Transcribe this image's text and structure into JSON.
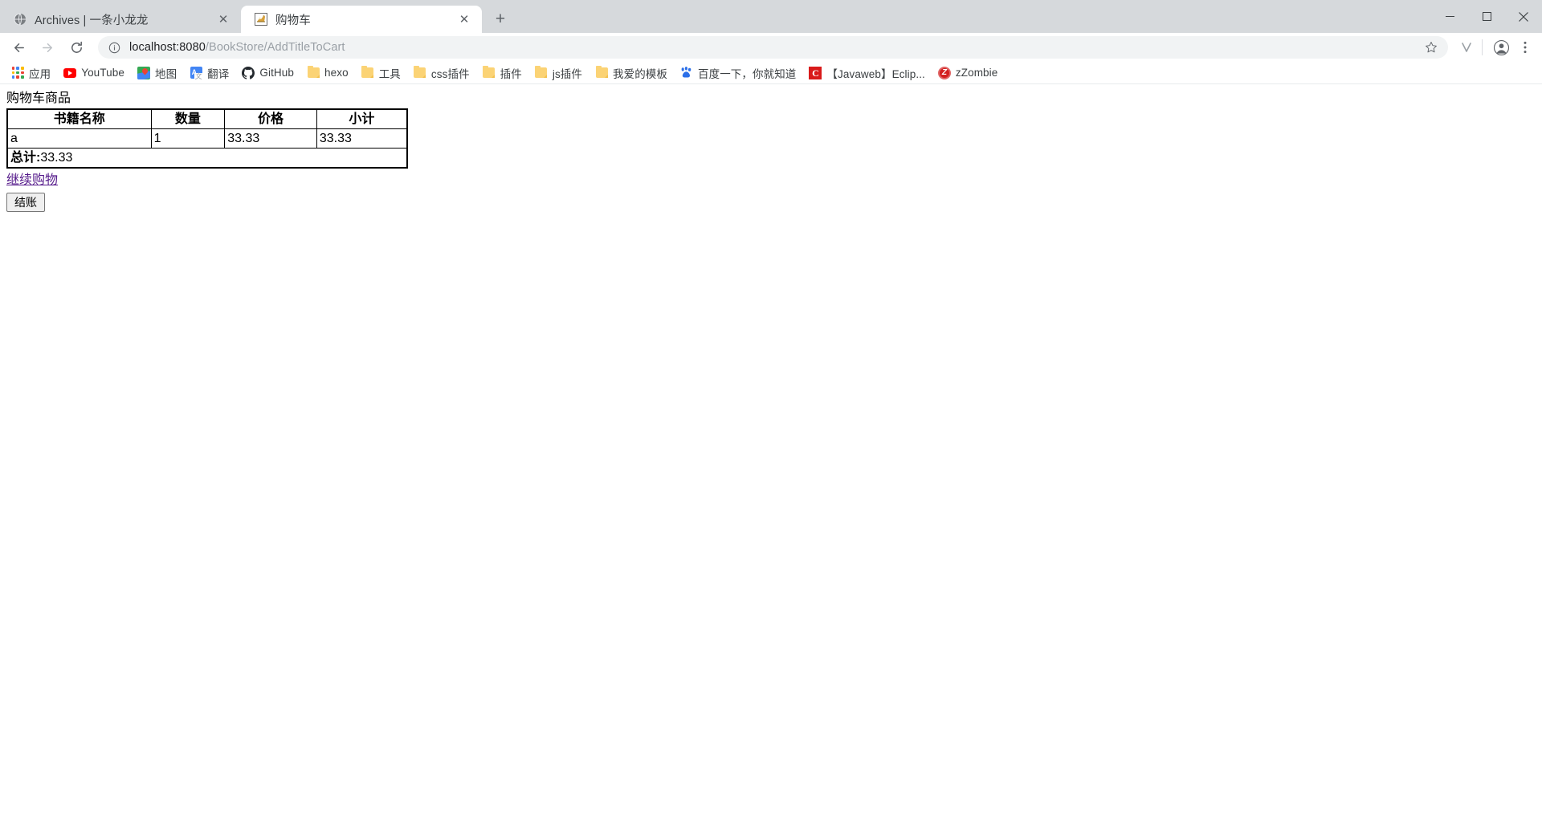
{
  "window": {
    "minimize_label": "Minimize",
    "maximize_label": "Maximize",
    "close_label": "Close"
  },
  "tabs": [
    {
      "title": "Archives | 一条小龙龙",
      "favicon": "globe-icon",
      "active": false,
      "close_label": "✕"
    },
    {
      "title": "购物车",
      "favicon": "tomcat-icon",
      "active": true,
      "close_label": "✕"
    }
  ],
  "newtab": {
    "label": "+"
  },
  "toolbar": {
    "back_label": "←",
    "forward_label": "→",
    "reload_label": "⟳",
    "info_icon": "info-circle-icon",
    "url_host": "localhost:8080",
    "url_path": "/BookStore/AddTitleToCart",
    "url_full": "localhost:8080/BookStore/AddTitleToCart",
    "star_label": "☆",
    "extension_label": "V",
    "profile_label": "profile-icon",
    "menu_label": "⋮"
  },
  "bookmarks": [
    {
      "label": "应用",
      "icon": "apps-grid-icon"
    },
    {
      "label": "YouTube",
      "icon": "youtube-icon"
    },
    {
      "label": "地图",
      "icon": "maps-pin-icon"
    },
    {
      "label": "翻译",
      "icon": "translate-icon"
    },
    {
      "label": "GitHub",
      "icon": "github-icon"
    },
    {
      "label": "hexo",
      "icon": "folder-icon"
    },
    {
      "label": "工具",
      "icon": "folder-icon"
    },
    {
      "label": "css插件",
      "icon": "folder-icon"
    },
    {
      "label": "插件",
      "icon": "folder-icon"
    },
    {
      "label": "js插件",
      "icon": "folder-icon"
    },
    {
      "label": "我爱的模板",
      "icon": "folder-icon"
    },
    {
      "label": "百度一下，你就知道",
      "icon": "baidu-icon"
    },
    {
      "label": "【Javaweb】Eclip...",
      "icon": "csdn-icon"
    },
    {
      "label": "zZombie",
      "icon": "zzombie-icon"
    }
  ],
  "page": {
    "heading": "购物车商品",
    "table": {
      "headers": [
        "书籍名称",
        "数量",
        "价格",
        "小计"
      ],
      "rows": [
        {
          "name": "a",
          "qty": "1",
          "price": "33.33",
          "subtotal": "33.33"
        }
      ],
      "total_label": "总计:",
      "total_value": "33.33"
    },
    "continue_link": "继续购物",
    "checkout_button": "结账"
  },
  "colors": {
    "tabstrip_bg": "#d6d9dc",
    "omnibox_bg": "#f1f3f4",
    "link_visited": "#551a8b",
    "text_primary": "#202124",
    "text_muted": "#9aa0a6"
  }
}
